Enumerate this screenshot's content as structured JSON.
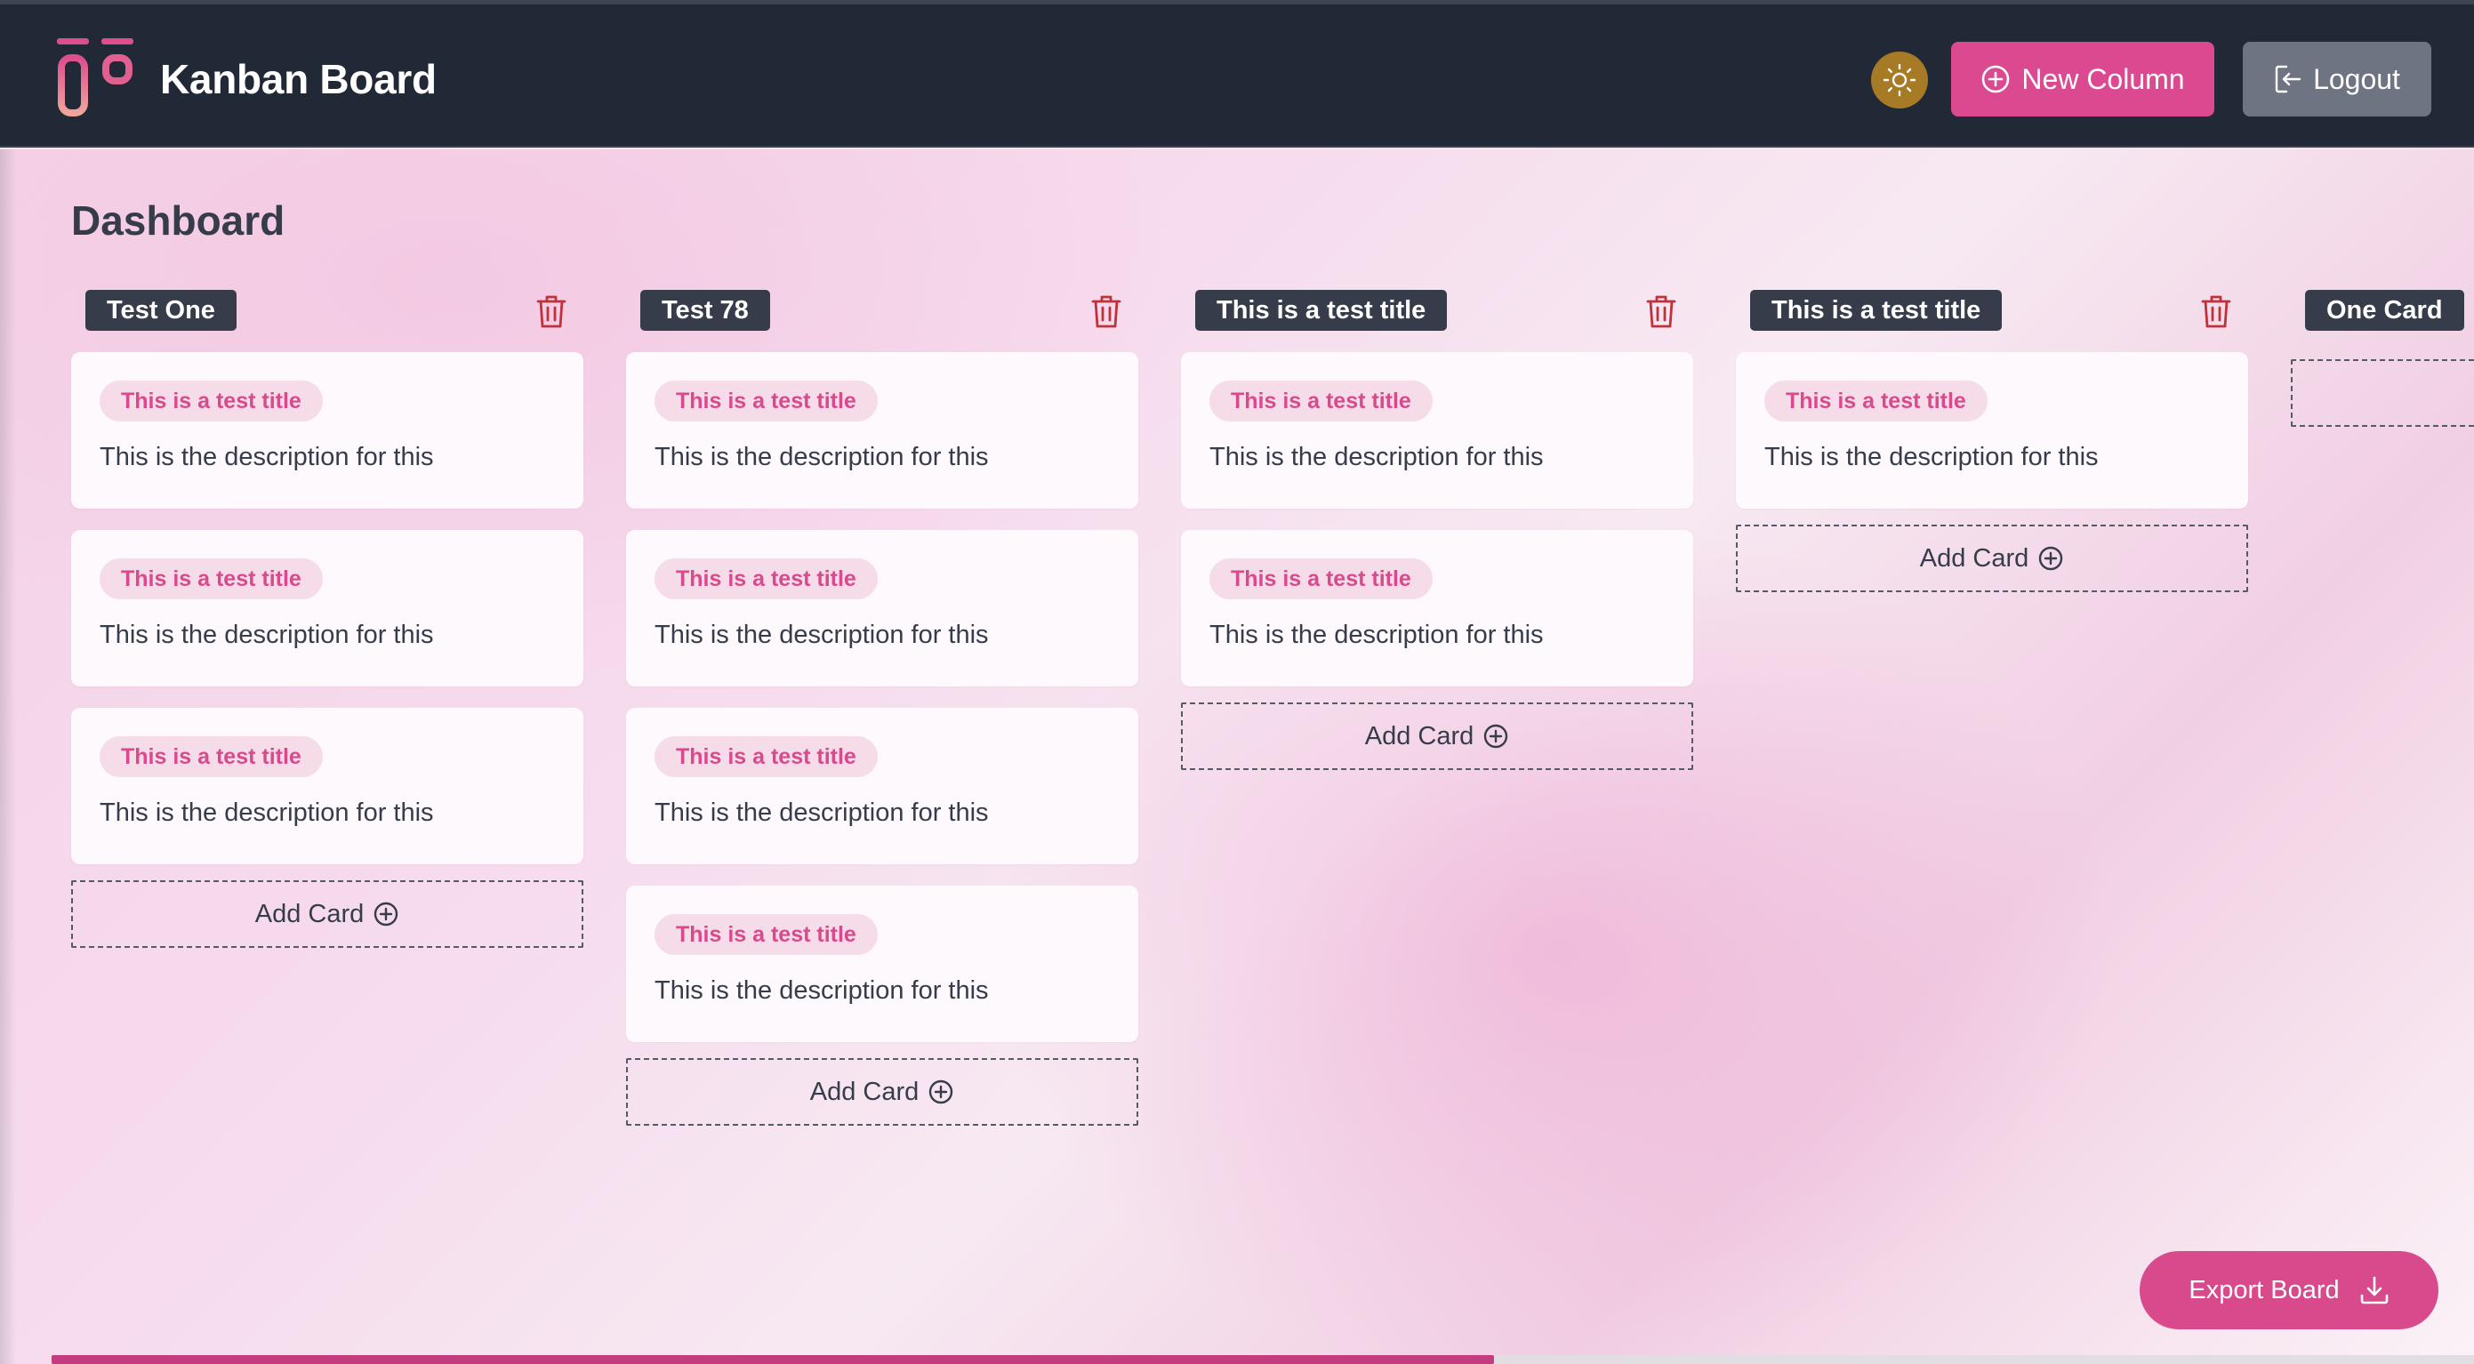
{
  "app": {
    "title": "Kanban Board",
    "logo_icon": "kanban-logo",
    "theme_icon": "sun-icon",
    "accent_color": "#db4a91"
  },
  "header": {
    "new_column_label": "New Column",
    "logout_label": "Logout"
  },
  "main": {
    "page_title": "Dashboard",
    "add_card_label": "Add Card",
    "export_label": "Export Board"
  },
  "columns": [
    {
      "title": "Test One",
      "cards": [
        {
          "tag": "This is a test title",
          "description": "This is the description for this"
        },
        {
          "tag": "This is a test title",
          "description": "This is the description for this"
        },
        {
          "tag": "This is a test title",
          "description": "This is the description for this"
        }
      ]
    },
    {
      "title": "Test 78",
      "cards": [
        {
          "tag": "This is a test title",
          "description": "This is the description for this"
        },
        {
          "tag": "This is a test title",
          "description": "This is the description for this"
        },
        {
          "tag": "This is a test title",
          "description": "This is the description for this"
        },
        {
          "tag": "This is a test title",
          "description": "This is the description for this"
        }
      ]
    },
    {
      "title": "This is a test title",
      "cards": [
        {
          "tag": "This is a test title",
          "description": "This is the description for this"
        },
        {
          "tag": "This is a test title",
          "description": "This is the description for this"
        }
      ]
    },
    {
      "title": "This is a test title",
      "cards": [
        {
          "tag": "This is a test title",
          "description": "This is the description for this"
        }
      ]
    },
    {
      "title": "One Card",
      "cards": []
    }
  ]
}
